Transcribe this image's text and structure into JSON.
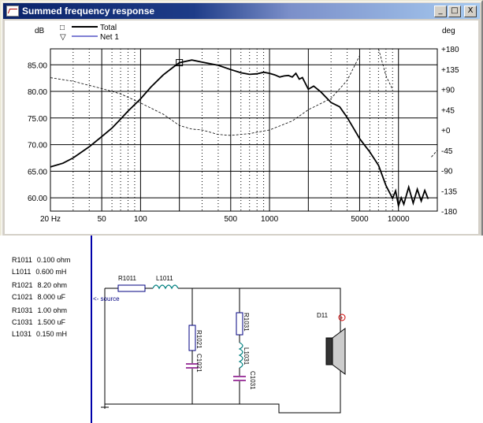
{
  "window": {
    "title": "Summed frequency response",
    "buttons": {
      "minimize": "_",
      "maximize": "□",
      "close": "X"
    }
  },
  "chart": {
    "left_axis_label": "dB",
    "right_axis_label": "deg",
    "legend": [
      {
        "symbol": "□",
        "name": "Total",
        "color": "#000000"
      },
      {
        "symbol": "▽",
        "name": "Net 1",
        "color": "#0000aa"
      }
    ],
    "x_tick_labels": [
      "20 Hz",
      "50",
      "100",
      "500",
      "1000",
      "5000",
      "10000"
    ],
    "y_left_tick_labels": [
      "85.00",
      "80.00",
      "75.00",
      "70.00",
      "65.00",
      "60.00"
    ],
    "y_right_tick_labels": [
      "+180",
      "+135",
      "+90",
      "+45",
      "+0",
      "-45",
      "-90",
      "-135",
      "-180"
    ]
  },
  "chart_data": {
    "type": "line",
    "xscale": "log",
    "xlim": [
      20,
      20000
    ],
    "ylim_left": [
      57.5,
      88
    ],
    "ylim_right": [
      -180,
      180
    ],
    "xlabel": "",
    "ylabel": "dB",
    "y2label": "deg",
    "grid": true,
    "legend": "top-left",
    "series": [
      {
        "name": "Total",
        "axis": "left",
        "style": "solid",
        "x": [
          20,
          25,
          30,
          40,
          50,
          60,
          70,
          80,
          100,
          120,
          150,
          180,
          200,
          250,
          300,
          400,
          500,
          600,
          700,
          800,
          900,
          1000,
          1100,
          1200,
          1300,
          1400,
          1500,
          1600,
          1700,
          1800,
          2000,
          2200,
          2500,
          3000,
          3500,
          4000,
          4500,
          5000,
          5500,
          6000,
          7000,
          8000,
          9000,
          9500,
          10000,
          10500,
          11000,
          12000,
          13000,
          14000,
          15000,
          16000,
          17000
        ],
        "y": [
          65.8,
          66.5,
          67.5,
          69.6,
          71.5,
          73.1,
          74.8,
          76.3,
          78.6,
          80.8,
          83.1,
          84.6,
          85.4,
          85.9,
          85.5,
          84.9,
          84.1,
          83.5,
          83.2,
          83.3,
          83.6,
          83.4,
          83.1,
          82.7,
          82.9,
          83.0,
          82.7,
          83.4,
          82.3,
          82.6,
          80.4,
          81.0,
          79.9,
          77.9,
          77.1,
          75.1,
          73.0,
          71.1,
          69.8,
          68.6,
          66.1,
          62.3,
          59.9,
          61.3,
          58.5,
          60.0,
          58.8,
          62.0,
          59.0,
          61.6,
          59.4,
          61.4,
          59.8
        ]
      },
      {
        "name": "Net 1",
        "axis": "right",
        "style": "dashed",
        "x": [
          20,
          30,
          50,
          70,
          100,
          150,
          200,
          250,
          300,
          400,
          500,
          700,
          1000,
          1500,
          2000,
          3000,
          4000,
          5000,
          6000,
          7000,
          8000,
          9000,
          10000,
          12000,
          14000,
          16000,
          18000,
          20000
        ],
        "y": [
          116,
          108,
          92,
          80,
          60,
          35,
          10,
          2,
          0,
          -10,
          -12,
          -8,
          0,
          20,
          45,
          70,
          110,
          165,
          -180,
          180,
          120,
          90,
          -120,
          160,
          -150,
          170,
          -60,
          -45
        ]
      }
    ]
  },
  "components": [
    {
      "name": "R1011",
      "value": "0.100 ohm"
    },
    {
      "name": "L1011",
      "value": "0.600 mH"
    },
    {
      "name": "R1021",
      "value": "8.20 ohm"
    },
    {
      "name": "C1021",
      "value": "8.000 uF"
    },
    {
      "name": "R1031",
      "value": "1.00 ohm"
    },
    {
      "name": "C1031",
      "value": "1.500 uF"
    },
    {
      "name": "L1031",
      "value": "0.150 mH"
    }
  ],
  "schematic": {
    "source_label": "<- source",
    "labels": {
      "R1011": "R1011",
      "L1011": "L1011",
      "R1021": "R1021",
      "C1021": "C1021",
      "R1031": "R1031",
      "L1031": "L1031",
      "C1031": "C1031",
      "D11": "D11",
      "plus": "+"
    }
  },
  "colors": {
    "title_start": "#0a246a",
    "grid": "#000000",
    "schematic_wire": "#000000",
    "resistor_fill": "#ffffff",
    "resistor_outline": "#000080",
    "inductor": "#008080",
    "capacitor": "#800080",
    "source_text": "#000080",
    "polarity": "#cc0000",
    "separator": "#0000aa"
  }
}
